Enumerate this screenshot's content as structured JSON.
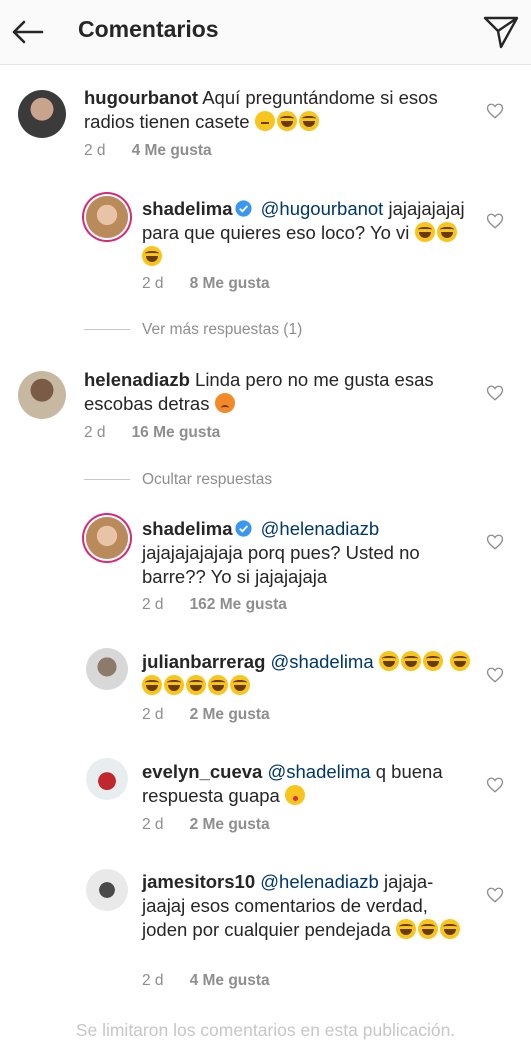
{
  "header": {
    "title": "Comentarios",
    "back_icon": "arrow-left-icon",
    "send_icon": "paper-plane-icon"
  },
  "comments": [
    {
      "username": "hugourbanot",
      "text": "Aquí preguntándome si esos radios tienen casete",
      "emojis": [
        "thinking-face",
        "face-with-tears-of-joy",
        "face-with-tears-of-joy"
      ],
      "time": "2 d",
      "likes": "4 Me gusta"
    },
    {
      "username": "shadelima",
      "verified": true,
      "mention": "@hugourbanot",
      "text": "jajajajajaj para que quieres eso loco? Yo vi",
      "emojis": [
        "face-with-tears-of-joy",
        "face-with-tears-of-joy",
        "face-with-tears-of-joy"
      ],
      "time": "2 d",
      "likes": "8 Me gusta"
    },
    {
      "username": "helenadiazb",
      "text": "Linda pero no me gusta  esas escobas detras",
      "emojis": [
        "sad-face"
      ],
      "time": "2 d",
      "likes": "16 Me gusta"
    },
    {
      "username": "shadelima",
      "verified": true,
      "mention": "@helenadiazb",
      "text": "jajajajajajaja porq pues? Usted no barre?? Yo si jajajajaja",
      "time": "2 d",
      "likes": "162 Me gusta"
    },
    {
      "username": "julianbarrerag",
      "mention": "@shadelima",
      "emojis": [
        "face-with-tears-of-joy",
        "face-with-tears-of-joy",
        "face-with-tears-of-joy",
        "face-with-tears-of-joy",
        "face-with-tears-of-joy",
        "face-with-tears-of-joy",
        "face-with-tears-of-joy",
        "face-with-tears-of-joy",
        "face-with-tears-of-joy"
      ],
      "time": "2 d",
      "likes": "2 Me gusta"
    },
    {
      "username": "evelyn_cueva",
      "mention": "@shadelima",
      "text": " q buena respuesta guapa",
      "emojis": [
        "face-blowing-kiss"
      ],
      "time": "2 d",
      "likes": "2 Me gusta"
    },
    {
      "username": "jamesitors10",
      "mention": "@helenadiazb",
      "text": "jajaja-jaajaj esos comentarios de verdad, joden por cualquier pendejada",
      "emojis": [
        "face-with-tears-of-joy",
        "face-with-tears-of-joy",
        "face-with-tears-of-joy"
      ],
      "time": "2 d",
      "likes": "4 Me gusta"
    }
  ],
  "replies_toggles": {
    "view_more": "Ver más respuestas (1)",
    "hide": "Ocultar respuestas"
  },
  "footer": {
    "limited_notice": "Se limitaron los comentarios en esta publicación."
  },
  "colors": {
    "mention": "#00376b",
    "muted": "#8e8e8e",
    "verified": "#3897f0"
  }
}
